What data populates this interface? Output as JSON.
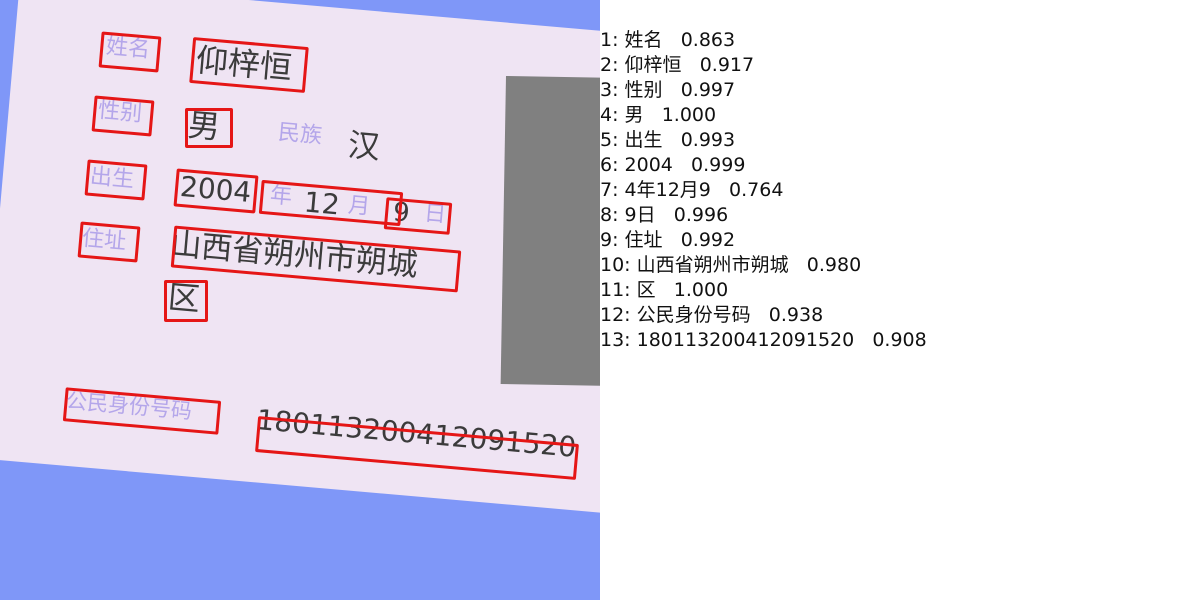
{
  "card": {
    "label_name": "姓名",
    "value_name": "仰梓恒",
    "label_gender": "性别",
    "value_gender": "男",
    "label_ethnicity": "民族",
    "value_ethnicity": "汉",
    "label_birth": "出生",
    "value_birth_year": "2004",
    "label_year": "年",
    "value_birth_month": "12",
    "label_month": "月",
    "value_birth_day": "9",
    "label_day": "日",
    "label_address": "住址",
    "value_address_line1": "山西省朔州市朔城",
    "value_address_line2": "区",
    "label_id": "公民身份号码",
    "value_id": "180113200412091520"
  },
  "results": [
    {
      "index": "1:",
      "text": "姓名",
      "score": "0.863"
    },
    {
      "index": "2:",
      "text": "仰梓恒",
      "score": "0.917"
    },
    {
      "index": "3:",
      "text": "性别",
      "score": "0.997"
    },
    {
      "index": "4:",
      "text": "男",
      "score": "1.000"
    },
    {
      "index": "5:",
      "text": "出生",
      "score": "0.993"
    },
    {
      "index": "6:",
      "text": "2004",
      "score": "0.999"
    },
    {
      "index": "7:",
      "text": "4年12月9",
      "score": "0.764"
    },
    {
      "index": "8:",
      "text": "9日",
      "score": "0.996"
    },
    {
      "index": "9:",
      "text": "住址",
      "score": "0.992"
    },
    {
      "index": "10:",
      "text": "山西省朔州市朔城",
      "score": "0.980"
    },
    {
      "index": "11:",
      "text": "区",
      "score": "1.000"
    },
    {
      "index": "12:",
      "text": "公民身份号码",
      "score": "0.938"
    },
    {
      "index": "13:",
      "text": "180113200412091520",
      "score": "0.908"
    }
  ],
  "colors": {
    "background": "#7f97f8",
    "card": "#efe4f3",
    "photo": "#808080",
    "box": "#e51616",
    "label_text": "#b4a6ea"
  }
}
